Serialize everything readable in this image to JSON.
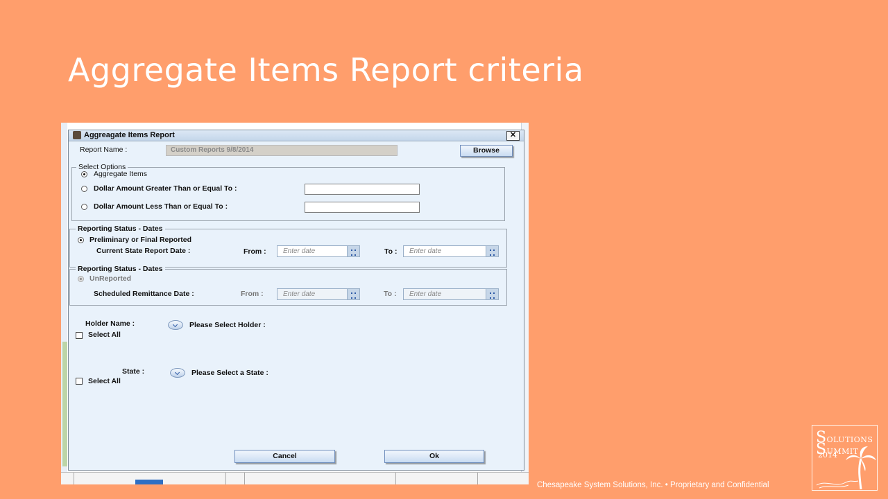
{
  "slide": {
    "title": "Aggregate Items Report criteria",
    "footer": "Chesapeake System Solutions, Inc. • Proprietary and Confidential",
    "logo": {
      "line1": "OLUTIONS",
      "line1_initial": "S",
      "line2": "UMMIT",
      "line2_initial": "S",
      "year": "2014"
    }
  },
  "dialog": {
    "title": "Aggreagate Items Report",
    "close_glyph": "✕",
    "report_name_label": "Report Name :",
    "report_name_value": "Custom Reports 9/8/2014",
    "browse_label": "Browse",
    "select_options": {
      "title": "Select Options",
      "options": [
        "Aggregate Items",
        "Dollar Amount Greater Than or Equal To :",
        "Dollar Amount Less Than or Equal To :"
      ],
      "selected_index": 0
    },
    "reporting_status_1": {
      "title": "Reporting Status - Dates",
      "radio_label": "Preliminary or Final Reported",
      "date_label": "Current State Report Date :",
      "from_label": "From :",
      "to_label": "To :",
      "from_placeholder": "Enter date",
      "to_placeholder": "Enter date"
    },
    "reporting_status_2": {
      "title": "Reporting Status - Dates",
      "radio_label": "UnReported",
      "date_label": "Scheduled Remittance Date :",
      "from_label": "From :",
      "to_label": "To :",
      "from_placeholder": "Enter date",
      "to_placeholder": "Enter date"
    },
    "holder": {
      "label": "Holder Name :",
      "placeholder": "Please Select Holder :",
      "select_all": "Select All"
    },
    "state": {
      "label": "State :",
      "placeholder": "Please Select a State :",
      "select_all": "Select All"
    },
    "cancel_label": "Cancel",
    "ok_label": "Ok"
  },
  "colors": {
    "slide_background": "#FF9E6C",
    "dialog_background": "#e9f2fb",
    "button_border": "#6f8ebd"
  }
}
